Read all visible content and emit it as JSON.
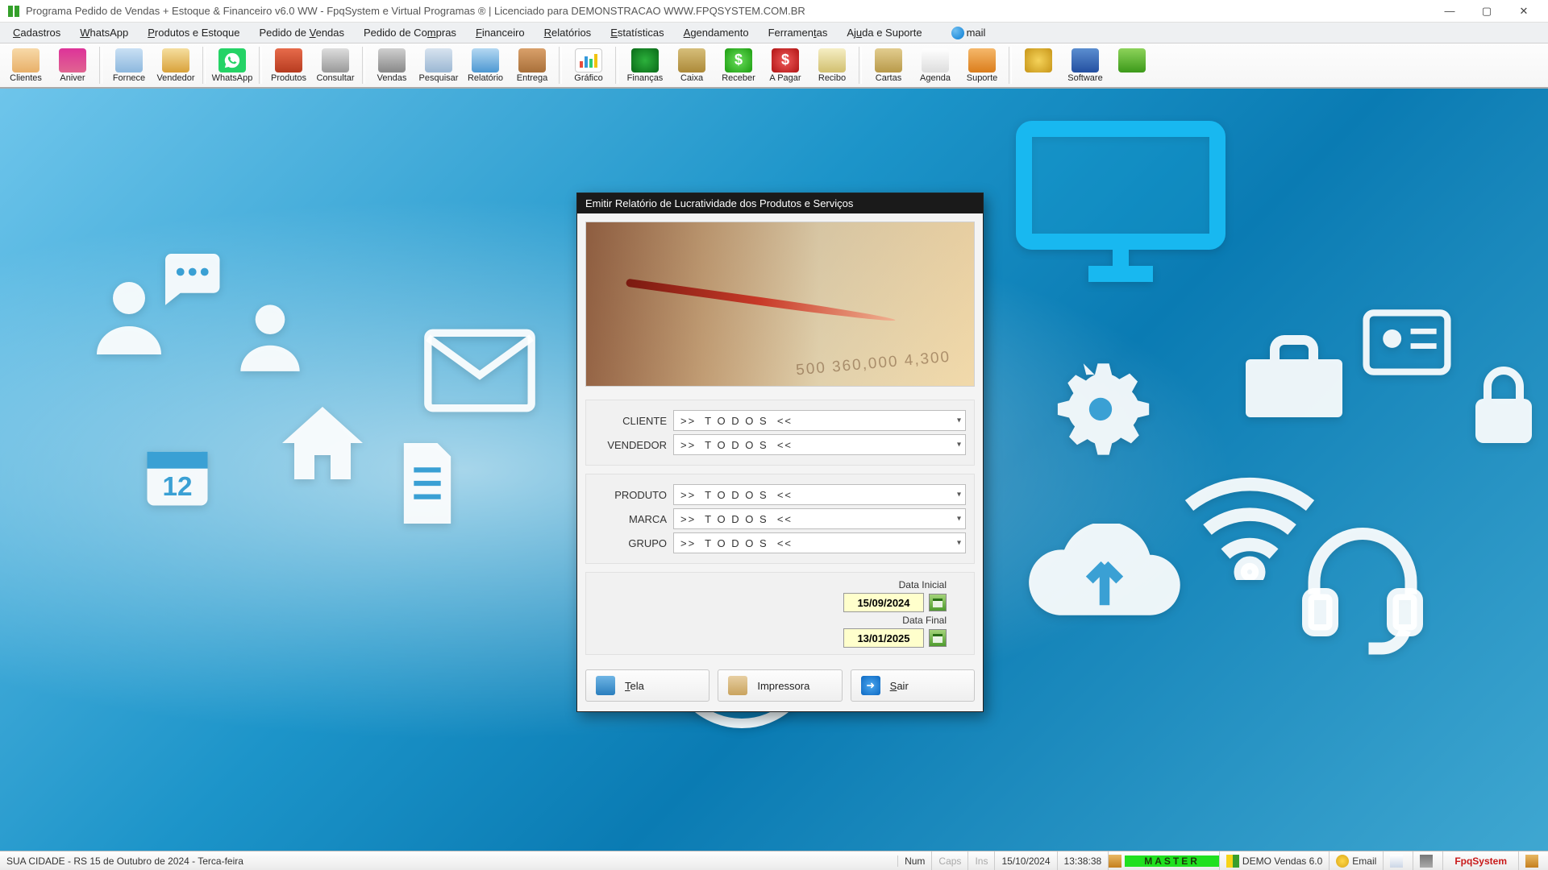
{
  "window": {
    "title": "Programa Pedido de Vendas + Estoque & Financeiro v6.0 WW - FpqSystem e Virtual Programas ® | Licenciado para  DEMONSTRACAO WWW.FPQSYSTEM.COM.BR"
  },
  "menu": {
    "cadastros": "Cadastros",
    "whatsapp": "WhatsApp",
    "produtos": "Produtos e Estoque",
    "pedido_vendas": "Pedido de Vendas",
    "pedido_compras": "Pedido de Compras",
    "financeiro": "Financeiro",
    "relatorios": "Relatórios",
    "estatisticas": "Estatísticas",
    "agendamento": "Agendamento",
    "ferramentas": "Ferramentas",
    "ajuda": "Ajuda e Suporte",
    "mail": "mail"
  },
  "toolbar": {
    "clientes": "Clientes",
    "aniver": "Aniver",
    "fornece": "Fornece",
    "vendedor": "Vendedor",
    "whatsapp": "WhatsApp",
    "produtos": "Produtos",
    "consultar": "Consultar",
    "vendas": "Vendas",
    "pesquisar": "Pesquisar",
    "relatorio": "Relatório",
    "entrega": "Entrega",
    "grafico": "Gráfico",
    "financas": "Finanças",
    "caixa": "Caixa",
    "receber": "Receber",
    "apagar": "A Pagar",
    "recibo": "Recibo",
    "cartas": "Cartas",
    "agenda": "Agenda",
    "suporte": "Suporte",
    "software": "Software"
  },
  "dialog": {
    "title": "Emitir Relatório de Lucratividade dos Produtos e Serviços",
    "labels": {
      "cliente": "CLIENTE",
      "vendedor": "VENDEDOR",
      "produto": "PRODUTO",
      "marca": "MARCA",
      "grupo": "GRUPO",
      "data_inicial": "Data Inicial",
      "data_final": "Data Final"
    },
    "values": {
      "cliente": ">>  T O D O S  <<",
      "vendedor": ">>  T O D O S  <<",
      "produto": ">>  T O D O S  <<",
      "marca": ">>  T O D O S  <<",
      "grupo": ">>  T O D O S  <<",
      "data_inicial": "15/09/2024",
      "data_final": "13/01/2025"
    },
    "buttons": {
      "tela": "Tela",
      "impressora": "Impressora",
      "sair": "Sair"
    }
  },
  "status": {
    "location": "SUA CIDADE - RS 15 de Outubro de 2024 - Terca-feira",
    "num": "Num",
    "caps": "Caps",
    "ins": "Ins",
    "date": "15/10/2024",
    "time": "13:38:38",
    "master": "MASTER",
    "demo": "DEMO Vendas 6.0",
    "email": "Email",
    "fpq": "FpqSystem"
  }
}
